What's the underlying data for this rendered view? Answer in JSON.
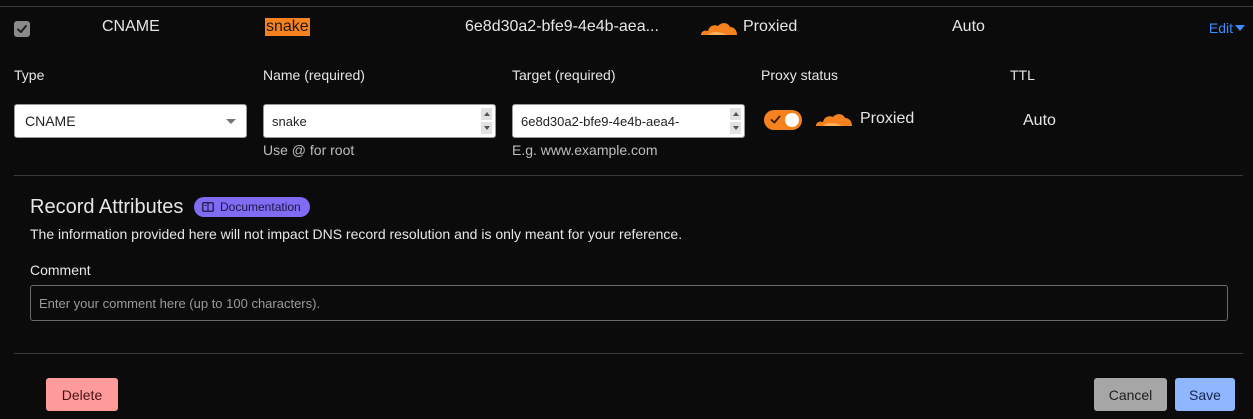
{
  "summary": {
    "type": "CNAME",
    "name": "snake",
    "target": "6e8d30a2-bfe9-4e4b-aea...",
    "proxy_status": "Proxied",
    "ttl": "Auto",
    "edit_label": "Edit"
  },
  "form": {
    "type_label": "Type",
    "name_label": "Name (required)",
    "target_label": "Target (required)",
    "proxy_label": "Proxy status",
    "ttl_label": "TTL",
    "type_value": "CNAME",
    "name_value": "snake",
    "target_value": "6e8d30a2-bfe9-4e4b-aea4-",
    "name_hint": "Use @ for root",
    "target_hint": "E.g. www.example.com",
    "proxy_value": "Proxied",
    "proxy_enabled": true,
    "ttl_value": "Auto"
  },
  "attributes": {
    "title": "Record Attributes",
    "doc_label": "Documentation",
    "description": "The information provided here will not impact DNS record resolution and is only meant for your reference.",
    "comment_label": "Comment",
    "comment_placeholder": "Enter your comment here (up to 100 characters)."
  },
  "actions": {
    "delete": "Delete",
    "cancel": "Cancel",
    "save": "Save"
  },
  "icons": {
    "row_checkbox": "checkbox-checked-icon",
    "cloud": "cloud-icon",
    "edit_caret": "caret-down-icon",
    "doc": "book-icon"
  },
  "colors": {
    "accent_orange": "#f6821f",
    "link_blue": "#3b8cff",
    "doc_badge": "#7f6cf2",
    "delete": "#ff9b9b",
    "save": "#8fb6ff"
  }
}
